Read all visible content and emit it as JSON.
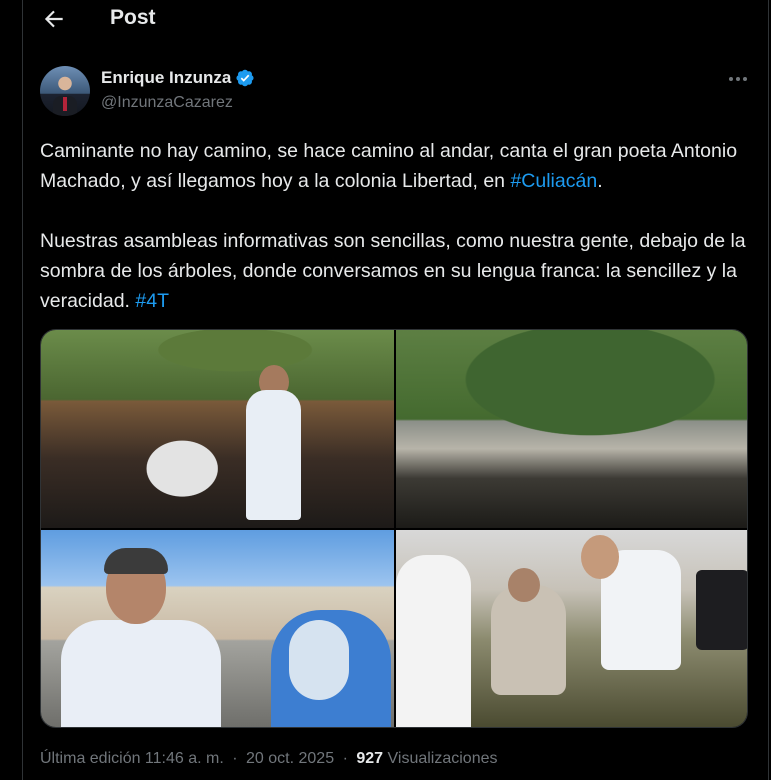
{
  "header": {
    "title": "Post",
    "back_icon": "arrow-left-icon"
  },
  "author": {
    "display_name": "Enrique Inzunza",
    "handle": "@InzunzaCazarez",
    "verified": true,
    "verified_color": "#1d9bf0"
  },
  "tweet": {
    "para1_text": "Caminante no hay camino, se hace camino al andar, canta el gran poeta Antonio Machado, y así llegamos hoy a la colonia Libertad, en ",
    "para1_hashtag": "#Culiacán",
    "para1_end": ".",
    "para2_text": "Nuestras asambleas informativas son sencillas, como nuestra gente, debajo de la sombra de los árboles, donde conversamos en su lengua franca: la sencillez y la veracidad. ",
    "para2_hashtag": "#4T"
  },
  "media": {
    "photo_count": 4
  },
  "meta": {
    "edited_label": "Última edición 11:46 a. m.",
    "separator": "·",
    "date": "20 oct. 2025",
    "views_count": "927",
    "views_label": "Visualizaciones"
  },
  "colors": {
    "background": "#000000",
    "text": "#e7e9ea",
    "secondary_text": "#71767b",
    "link": "#1d9bf0",
    "border": "#2f3336"
  }
}
